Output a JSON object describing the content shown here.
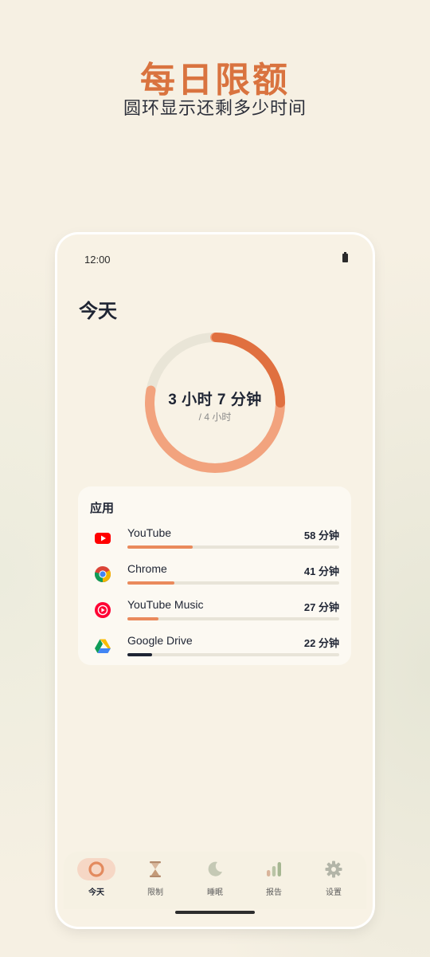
{
  "promo": {
    "title": "每日限额",
    "subtitle": "圆环显示还剩多少时间"
  },
  "status_bar": {
    "time": "12:00",
    "battery_icon": "battery-icon"
  },
  "page": {
    "title": "今天"
  },
  "usage_ring": {
    "used_label": "3 小时 7 分钟",
    "limit_label": "/ 4 小时",
    "used_fraction": 0.78,
    "colors": {
      "track": "#e9e5d7",
      "light": "#f2a37e",
      "dark": "#e07040"
    }
  },
  "apps": {
    "heading": "应用",
    "items": [
      {
        "name": "YouTube",
        "time": "58 分钟",
        "fraction": 0.31,
        "icon": "youtube-icon",
        "bar_color": "#ea8a5c"
      },
      {
        "name": "Chrome",
        "time": "41 分钟",
        "fraction": 0.22,
        "icon": "chrome-icon",
        "bar_color": "#ea8a5c"
      },
      {
        "name": "YouTube Music",
        "time": "27 分钟",
        "fraction": 0.145,
        "icon": "youtube-music-icon",
        "bar_color": "#ea8a5c"
      },
      {
        "name": "Google Drive",
        "time": "22 分钟",
        "fraction": 0.115,
        "icon": "google-drive-icon",
        "bar_color": "#1e2433"
      }
    ]
  },
  "nav": {
    "items": [
      {
        "label": "今天",
        "icon": "ring-icon",
        "active": true
      },
      {
        "label": "限制",
        "icon": "hourglass-icon",
        "active": false
      },
      {
        "label": "睡眠",
        "icon": "moon-icon",
        "active": false
      },
      {
        "label": "报告",
        "icon": "bar-chart-icon",
        "active": false
      },
      {
        "label": "设置",
        "icon": "gear-icon",
        "active": false
      }
    ]
  },
  "colors": {
    "accent": "#d9733f",
    "text_dark": "#1e2433",
    "background": "#f6f0e3"
  }
}
